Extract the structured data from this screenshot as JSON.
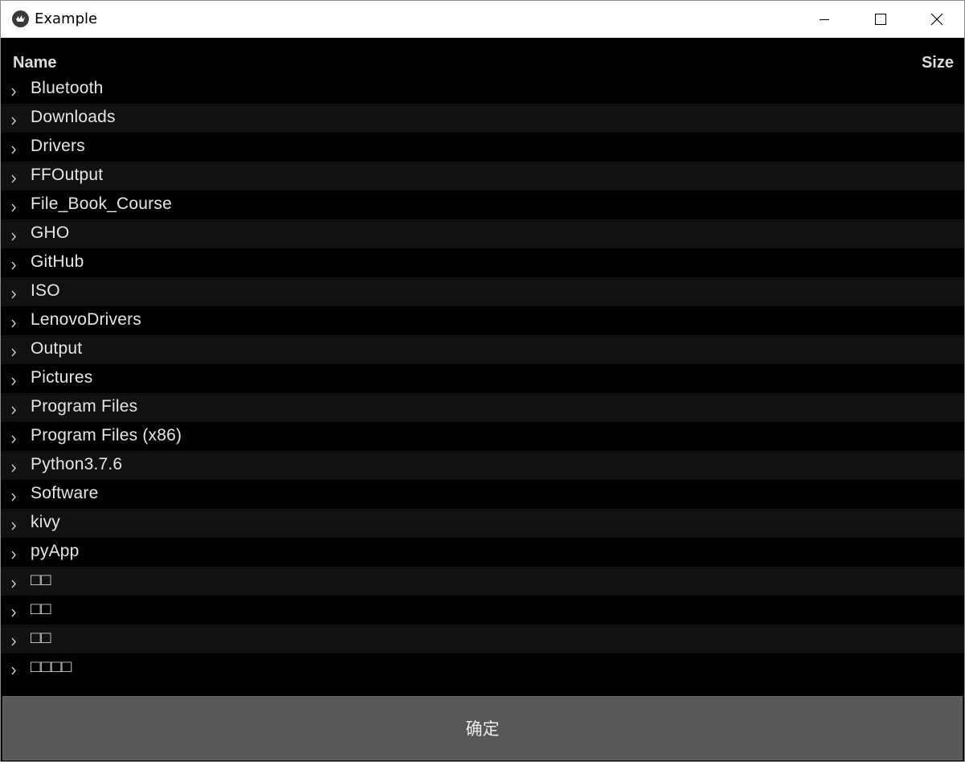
{
  "window": {
    "title": "Example"
  },
  "icons": {
    "app": "kivy-logo-icon",
    "minimize": "minimize-icon",
    "maximize": "maximize-icon",
    "close": "close-icon",
    "expand": "chevron-right-icon"
  },
  "file_browser": {
    "columns": {
      "name": "Name",
      "size": "Size"
    },
    "entries": [
      "Bluetooth",
      "Downloads",
      "Drivers",
      "FFOutput",
      "File_Book_Course",
      "GHO",
      "GitHub",
      "ISO",
      "LenovoDrivers",
      "Output",
      "Pictures",
      "Program Files",
      "Program Files (x86)",
      "Python3.7.6",
      "Software",
      "kivy",
      "pyApp",
      "□□",
      "□□",
      "□□",
      "□□□□"
    ]
  },
  "confirm_button": {
    "label": "确定"
  },
  "colors": {
    "background": "#000000",
    "row_alt": "#111111",
    "button": "#585858",
    "text": "#e6e6e6"
  }
}
